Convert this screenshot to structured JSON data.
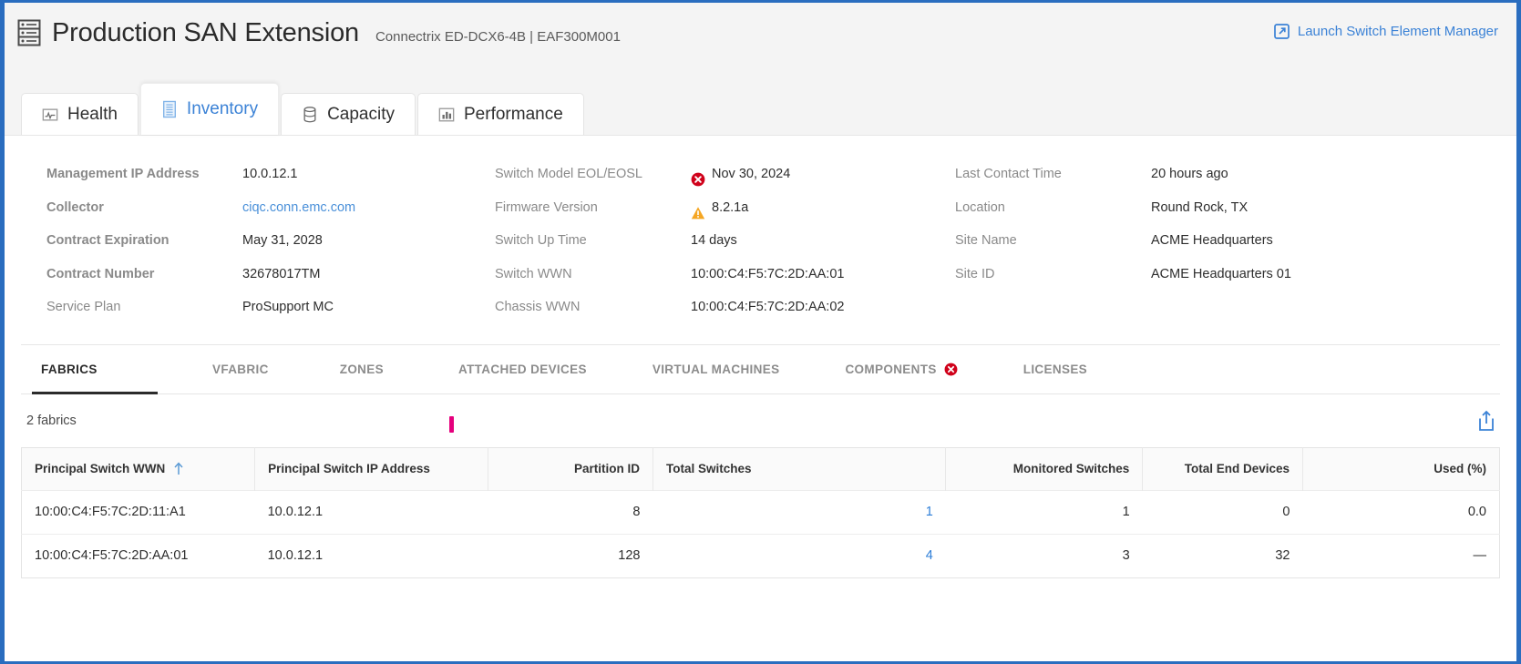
{
  "header": {
    "icon": "chassis-icon",
    "title": "Production SAN Extension",
    "subtitle": "Connectrix ED-DCX6-4B | EAF300M001",
    "launch_link": "Launch Switch Element Manager",
    "launch_icon": "external-link-icon"
  },
  "tabs": [
    {
      "label": "Health",
      "icon": "health-pulse-icon",
      "active": false
    },
    {
      "label": "Inventory",
      "icon": "inventory-list-icon",
      "active": true
    },
    {
      "label": "Capacity",
      "icon": "capacity-database-icon",
      "active": false
    },
    {
      "label": "Performance",
      "icon": "performance-bars-icon",
      "active": false
    }
  ],
  "details": {
    "col1": [
      {
        "label": "Management IP Address",
        "value": "10.0.12.1",
        "link": false,
        "status": ""
      },
      {
        "label": "Collector",
        "value": "ciqc.conn.emc.com",
        "link": true,
        "status": ""
      },
      {
        "label": "Contract Expiration",
        "value": "May 31, 2028",
        "link": false,
        "status": ""
      },
      {
        "label": "Contract Number",
        "value": "32678017TM",
        "link": false,
        "status": ""
      },
      {
        "label": "Service Plan",
        "value": "ProSupport MC",
        "link": false,
        "status": ""
      }
    ],
    "col2": [
      {
        "label": "Switch Model EOL/EOSL",
        "value": "Nov 30, 2024",
        "link": false,
        "status": "error"
      },
      {
        "label": "Firmware Version",
        "value": "8.2.1a",
        "link": false,
        "status": "warning"
      },
      {
        "label": "Switch Up Time",
        "value": "14 days",
        "link": false,
        "status": ""
      },
      {
        "label": "Switch WWN",
        "value": "10:00:C4:F5:7C:2D:AA:01",
        "link": false,
        "status": ""
      },
      {
        "label": "Chassis WWN",
        "value": "10:00:C4:F5:7C:2D:AA:02",
        "link": false,
        "status": ""
      }
    ],
    "col3": [
      {
        "label": "Last Contact Time",
        "value": "20 hours ago",
        "link": false,
        "status": ""
      },
      {
        "label": "Location",
        "value": "Round Rock, TX",
        "link": false,
        "status": ""
      },
      {
        "label": "Site Name",
        "value": "ACME Headquarters",
        "link": false,
        "status": ""
      },
      {
        "label": "Site ID",
        "value": "ACME Headquarters 01",
        "link": false,
        "status": ""
      }
    ]
  },
  "subtabs": [
    {
      "label": "FABRICS",
      "active": true,
      "badge": ""
    },
    {
      "label": "VFABRIC",
      "active": false,
      "badge": ""
    },
    {
      "label": "ZONES",
      "active": false,
      "badge": ""
    },
    {
      "label": "ATTACHED DEVICES",
      "active": false,
      "badge": ""
    },
    {
      "label": "VIRTUAL MACHINES",
      "active": false,
      "badge": ""
    },
    {
      "label": "COMPONENTS",
      "active": false,
      "badge": "error"
    },
    {
      "label": "LICENSES",
      "active": false,
      "badge": ""
    }
  ],
  "table": {
    "count_label": "2 fabrics",
    "export_icon": "export-share-icon",
    "sort_column": "Principal Switch WWN",
    "sort_direction": "ascending",
    "sort_icon": "arrow-up-icon",
    "columns": [
      {
        "label": "Principal Switch WWN",
        "align": "left",
        "sorted": true
      },
      {
        "label": "Principal Switch IP Address",
        "align": "left",
        "sorted": false
      },
      {
        "label": "Partition ID",
        "align": "right",
        "sorted": false
      },
      {
        "label": "Total Switches",
        "align": "left",
        "sorted": false
      },
      {
        "label": "Monitored Switches",
        "align": "right",
        "sorted": false
      },
      {
        "label": "Total End Devices",
        "align": "right",
        "sorted": false
      },
      {
        "label": "Used (%)",
        "align": "right",
        "sorted": false
      }
    ],
    "rows": [
      {
        "wwn": "10:00:C4:F5:7C:2D:11:A1",
        "ip": "10.0.12.1",
        "partition_id": "8",
        "total_switches": "1",
        "monitored_switches": "1",
        "total_end_devices": "0",
        "used_pct": "0.0"
      },
      {
        "wwn": "10:00:C4:F5:7C:2D:AA:01",
        "ip": "10.0.12.1",
        "partition_id": "128",
        "total_switches": "4",
        "monitored_switches": "3",
        "total_end_devices": "32",
        "used_pct": "—"
      }
    ]
  },
  "colors": {
    "accent_blue": "#3b82d6",
    "link_blue": "#2f7fd8",
    "error_red": "#d0021b",
    "warning_amber": "#f5a623",
    "frame_blue": "#2a6dbf",
    "drag_marker_magenta": "#e5007d"
  }
}
